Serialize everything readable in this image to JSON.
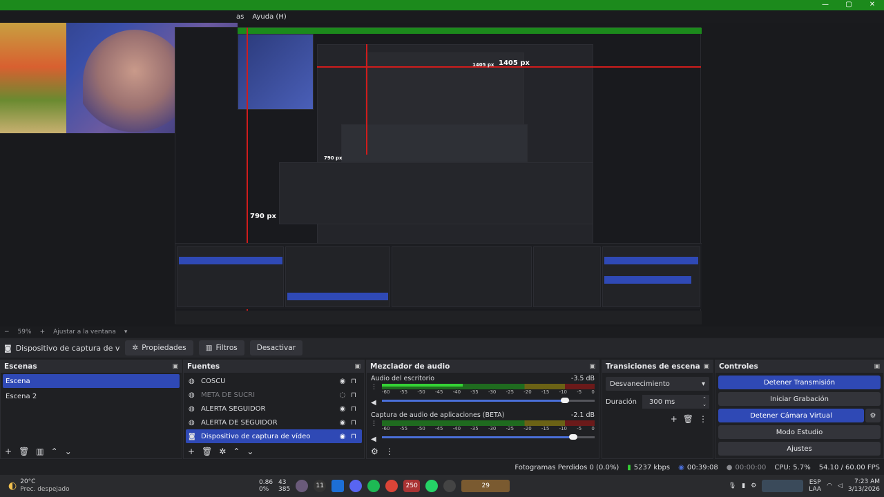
{
  "window": {
    "menu_partial": "as",
    "menu_help": "Ayuda (H)",
    "minimize": "—",
    "maximize": "▢",
    "close": "✕"
  },
  "preview": {
    "label_1405": "1405 px",
    "label_790": "790 px",
    "mini_label_1405": "1405 px",
    "mini_label_790": "790 px"
  },
  "zoom": {
    "minus": "−",
    "value": "59%",
    "plus": "+",
    "fit": "Ajustar a la ventana",
    "dropdown": "▾"
  },
  "source_toolbar": {
    "current_source": "Dispositivo de captura de v",
    "properties": "Propiedades",
    "filters": "Filtros",
    "deactivate": "Desactivar"
  },
  "scenes": {
    "title": "Escenas",
    "items": [
      {
        "label": "Escena",
        "selected": true
      },
      {
        "label": "Escena 2",
        "selected": false
      }
    ]
  },
  "sources": {
    "title": "Fuentes",
    "items": [
      {
        "label": "COSCU",
        "dim": false,
        "selected": false
      },
      {
        "label": "META DE SUCRI",
        "dim": true,
        "selected": false
      },
      {
        "label": "ALERTA SEGUIDOR",
        "dim": false,
        "selected": false
      },
      {
        "label": "ALERTA DE SEGUIDOR",
        "dim": false,
        "selected": false
      },
      {
        "label": "Dispositivo de captura de vídeo",
        "dim": false,
        "selected": true
      }
    ]
  },
  "mixer": {
    "title": "Mezclador de audio",
    "ticks": [
      "-60",
      "-55",
      "-50",
      "-45",
      "-40",
      "-35",
      "-30",
      "-25",
      "-20",
      "-15",
      "-10",
      "-5",
      "0"
    ],
    "channels": [
      {
        "name": "Audio del escritorio",
        "db": "-3.5 dB",
        "level": 0.38,
        "volume": 0.86
      },
      {
        "name": "Captura de audio de aplicaciones (BETA)",
        "db": "-2.1 dB",
        "level": 0.0,
        "volume": 0.9
      }
    ]
  },
  "transitions": {
    "title": "Transiciones de escena",
    "type": "Desvanecimiento",
    "duration_label": "Duración",
    "duration_value": "300 ms"
  },
  "controls": {
    "title": "Controles",
    "stop_stream": "Detener Transmisión",
    "start_recording": "Iniciar Grabación",
    "stop_virtual_cam": "Detener Cámara Virtual",
    "studio_mode": "Modo Estudio",
    "settings": "Ajustes"
  },
  "status": {
    "dropped_frames": "Fotogramas Perdidos 0 (0.0%)",
    "bitrate": "5237 kbps",
    "stream_time": "00:39:08",
    "rec_time": "00:00:00",
    "cpu": "CPU: 5.7%",
    "fps": "54.10 / 60.00 FPS"
  },
  "taskbar": {
    "temperature": "20°C",
    "weather": "Prec. despejado",
    "stat1_top": "0.86",
    "stat1_bottom": "0%",
    "stat2_top": "43",
    "stat2_bottom": "385",
    "badge_11": "11",
    "badge_250": "250",
    "badge_29": "29",
    "lang": "ESP",
    "lang2": "LAA",
    "time": "7:23 AM",
    "date": "3/13/2026"
  },
  "colors": {
    "accent": "#2f49b5",
    "titlebar": "#1c8a1c",
    "measure_line": "#d01c1c"
  }
}
